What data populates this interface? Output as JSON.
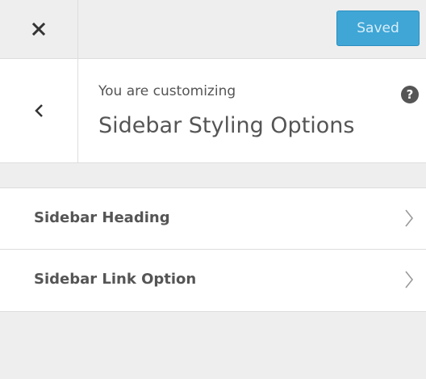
{
  "topbar": {
    "close_icon": "close-icon",
    "save_label": "Saved",
    "save_color": "#3fa6d6"
  },
  "section": {
    "back_icon": "chevron-left-icon",
    "customizing_label": "You are customizing",
    "title": "Sidebar Styling Options",
    "help_icon": "help-icon",
    "help_glyph": "?"
  },
  "controls": [
    {
      "label": "Sidebar Heading",
      "icon": "chevron-right-icon"
    },
    {
      "label": "Sidebar Link Option",
      "icon": "chevron-right-icon"
    }
  ]
}
